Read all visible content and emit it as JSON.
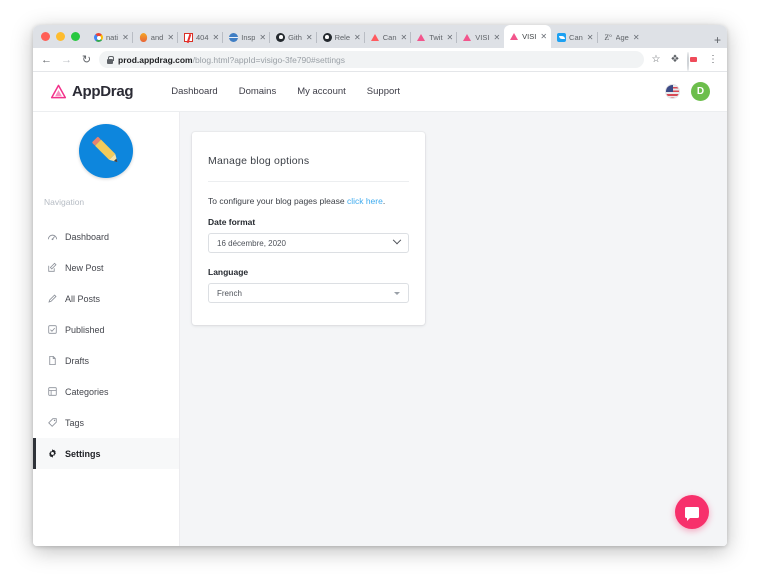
{
  "browser": {
    "traffic_lights": [
      "close",
      "minimize",
      "maximize"
    ],
    "tabs": [
      {
        "label": "nati",
        "favicon": "google-icon",
        "active": false
      },
      {
        "label": "and",
        "favicon": "flame-icon",
        "active": false
      },
      {
        "label": "404",
        "favicon": "slash-icon",
        "active": false
      },
      {
        "label": "Insp",
        "favicon": "globe-icon",
        "active": false
      },
      {
        "label": "Gith",
        "favicon": "github-icon",
        "active": false
      },
      {
        "label": "Rele",
        "favicon": "github-icon",
        "active": false
      },
      {
        "label": "Can",
        "favicon": "airbnb-icon",
        "active": false
      },
      {
        "label": "Twit",
        "favicon": "triangle-icon",
        "active": false
      },
      {
        "label": "VISI",
        "favicon": "triangle-icon",
        "active": false
      },
      {
        "label": "VISI",
        "favicon": "triangle-icon",
        "active": true
      },
      {
        "label": "Can",
        "favicon": "twitter-icon",
        "active": false
      },
      {
        "label": "Age",
        "favicon": "go-icon",
        "active": false
      }
    ],
    "new_tab_label": "+",
    "close_glyph": "✕",
    "back_label": "←",
    "forward_label": "→",
    "reload_label": "↻",
    "url_host": "prod.appdrag.com",
    "url_path": "/blog.html?appId=visigo-3fe790#settings",
    "star_glyph": "☆",
    "puzzle_glyph": "❖",
    "menu_glyph": "⋮"
  },
  "app": {
    "brand": "AppDrag",
    "nav": [
      {
        "label": "Dashboard"
      },
      {
        "label": "Domains"
      },
      {
        "label": "My account"
      },
      {
        "label": "Support"
      }
    ],
    "language_flag": "us-flag-icon",
    "account_initial": "D"
  },
  "sidebar": {
    "avatar_icon": "pencil-icon",
    "section_label": "Navigation",
    "items": [
      {
        "label": "Dashboard",
        "icon": "gauge-icon",
        "active": false
      },
      {
        "label": "New Post",
        "icon": "compose-icon",
        "active": false
      },
      {
        "label": "All Posts",
        "icon": "pencil-icon",
        "active": false
      },
      {
        "label": "Published",
        "icon": "checkbox-icon",
        "active": false
      },
      {
        "label": "Drafts",
        "icon": "file-icon",
        "active": false
      },
      {
        "label": "Categories",
        "icon": "list-icon",
        "active": false
      },
      {
        "label": "Tags",
        "icon": "tag-icon",
        "active": false
      },
      {
        "label": "Settings",
        "icon": "gear-icon",
        "active": true
      }
    ]
  },
  "card": {
    "title": "Manage blog options",
    "helper_prefix": "To configure your blog pages please ",
    "helper_link": "click here",
    "helper_suffix": ".",
    "date_format_label": "Date format",
    "date_format_value": "16 décembre, 2020",
    "language_label": "Language",
    "language_value": "French"
  },
  "chat": {
    "icon": "chat-bubble-icon",
    "color": "#f7306b"
  }
}
